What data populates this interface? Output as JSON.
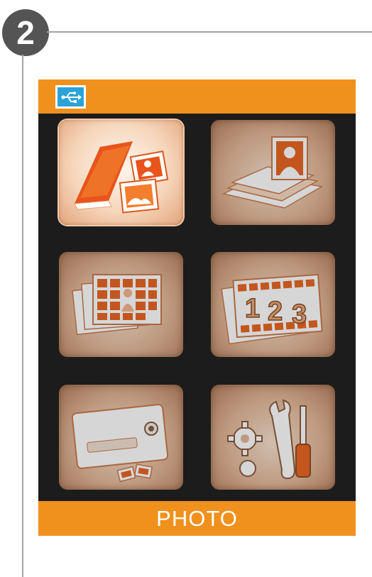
{
  "step": {
    "number": "2"
  },
  "device": {
    "status_bar": {
      "usb_icon": "usb-icon"
    },
    "menu": {
      "items": [
        {
          "icon": "photo-album-icon",
          "selected": true
        },
        {
          "icon": "photo-stack-icon",
          "selected": false
        },
        {
          "icon": "slideshow-icon",
          "selected": false
        },
        {
          "icon": "thumbnail-123-icon",
          "selected": false
        },
        {
          "icon": "camera-card-icon",
          "selected": false
        },
        {
          "icon": "settings-tools-icon",
          "selected": false
        }
      ]
    },
    "footer": {
      "label": "PHOTO"
    }
  },
  "colors": {
    "accent": "#f0911e",
    "screen_bg": "#1c1c1c",
    "usb_box": "#2aa3d8",
    "badge": "#545454"
  }
}
